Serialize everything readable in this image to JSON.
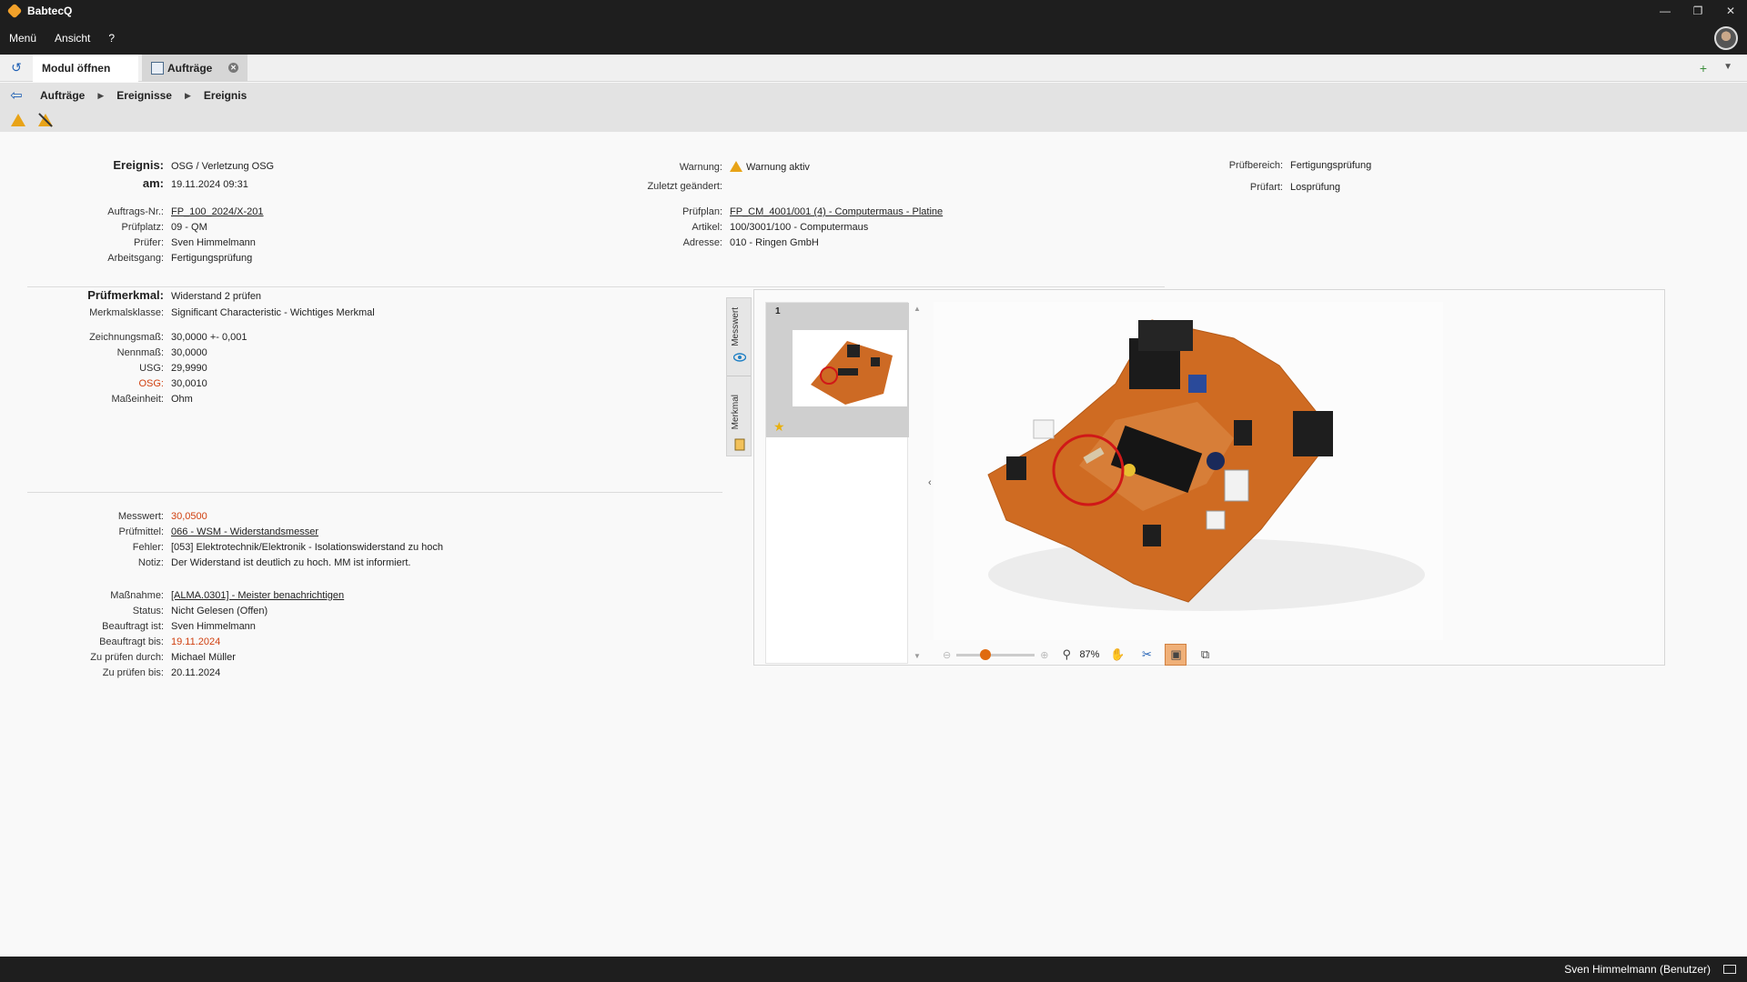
{
  "app": {
    "title": "BabtecQ"
  },
  "menu": {
    "items": [
      "Menü",
      "Ansicht",
      "?"
    ]
  },
  "tabs": {
    "open_label": "Modul öffnen",
    "active_label": "Aufträge"
  },
  "breadcrumb": [
    "Aufträge",
    "Ereignisse",
    "Ereignis"
  ],
  "header": {
    "ereignis_label": "Ereignis:",
    "ereignis_value": "OSG / Verletzung OSG",
    "am_label": "am:",
    "am_value": "19.11.2024 09:31",
    "auftrag_label": "Auftrags-Nr.:",
    "auftrag_value": "FP_100_2024/X-201",
    "pruefplatz_label": "Prüfplatz:",
    "pruefplatz_value": "09 - QM",
    "pruefer_label": "Prüfer:",
    "pruefer_value": "Sven Himmelmann",
    "arbeitsgang_label": "Arbeitsgang:",
    "arbeitsgang_value": "Fertigungsprüfung",
    "warnung_label": "Warnung:",
    "warnung_value": "Warnung aktiv",
    "zuletzt_label": "Zuletzt geändert:",
    "pruefplan_label": "Prüfplan:",
    "pruefplan_value": "FP_CM_4001/001 (4) - Computermaus - Platine",
    "artikel_label": "Artikel:",
    "artikel_value": "100/3001/100 - Computermaus",
    "adresse_label": "Adresse:",
    "adresse_value": "010 - Ringen GmbH",
    "pruefbereich_label": "Prüfbereich:",
    "pruefbereich_value": "Fertigungsprüfung",
    "prueftart_label": "Prüfart:",
    "prueftart_value": "Losprüfung"
  },
  "merkmal": {
    "pruefmerkmal_label": "Prüfmerkmal:",
    "pruefmerkmal_value": "Widerstand 2 prüfen",
    "klasse_label": "Merkmalsklasse:",
    "klasse_value": "Significant Characteristic - Wichtiges Merkmal",
    "zeichnung_label": "Zeichnungsmaß:",
    "zeichnung_value": "30,0000 +- 0,001",
    "nennmass_label": "Nennmaß:",
    "nennmass_value": "30,0000",
    "usg_label": "USG:",
    "usg_value": "29,9990",
    "osg_label": "OSG:",
    "osg_value": "30,0010",
    "einheit_label": "Maßeinheit:",
    "einheit_value": "Ohm"
  },
  "messung": {
    "messwert_label": "Messwert:",
    "messwert_value": "30,0500",
    "pruefmittel_label": "Prüfmittel:",
    "pruefmittel_value": "066 - WSM - Widerstandsmesser",
    "fehler_label": "Fehler:",
    "fehler_value": "[053] Elektrotechnik/Elektronik - Isolationswiderstand zu hoch",
    "notiz_label": "Notiz:",
    "notiz_value": "Der Widerstand ist deutlich zu hoch. MM ist informiert.",
    "massnahme_label": "Maßnahme:",
    "massnahme_value": "[ALMA.0301] - Meister benachrichtigen",
    "status_label": "Status:",
    "status_value": "Nicht Gelesen (Offen)",
    "beauftragt_label": "Beauftragt ist:",
    "beauftragt_value": "Sven Himmelmann",
    "beauftragt_bis_label": "Beauftragt bis:",
    "beauftragt_bis_value": "19.11.2024",
    "zu_pruefen_durch_label": "Zu prüfen durch:",
    "zu_pruefen_durch_value": "Michael Müller",
    "zu_pruefen_bis_label": "Zu prüfen bis:",
    "zu_pruefen_bis_value": "20.11.2024"
  },
  "viewer": {
    "vtab_messwert": "Messwert",
    "vtab_merkmal": "Merkmal",
    "thumb_number": "1",
    "zoom_percent": "87%",
    "zoom_slider_fraction": 0.37
  },
  "status": {
    "user": "Sven Himmelmann (Benutzer)"
  },
  "colors": {
    "accent": "#e06a10",
    "link": "#1e5fb4",
    "warning": "#e8a317",
    "limit_red": "#d04010"
  }
}
